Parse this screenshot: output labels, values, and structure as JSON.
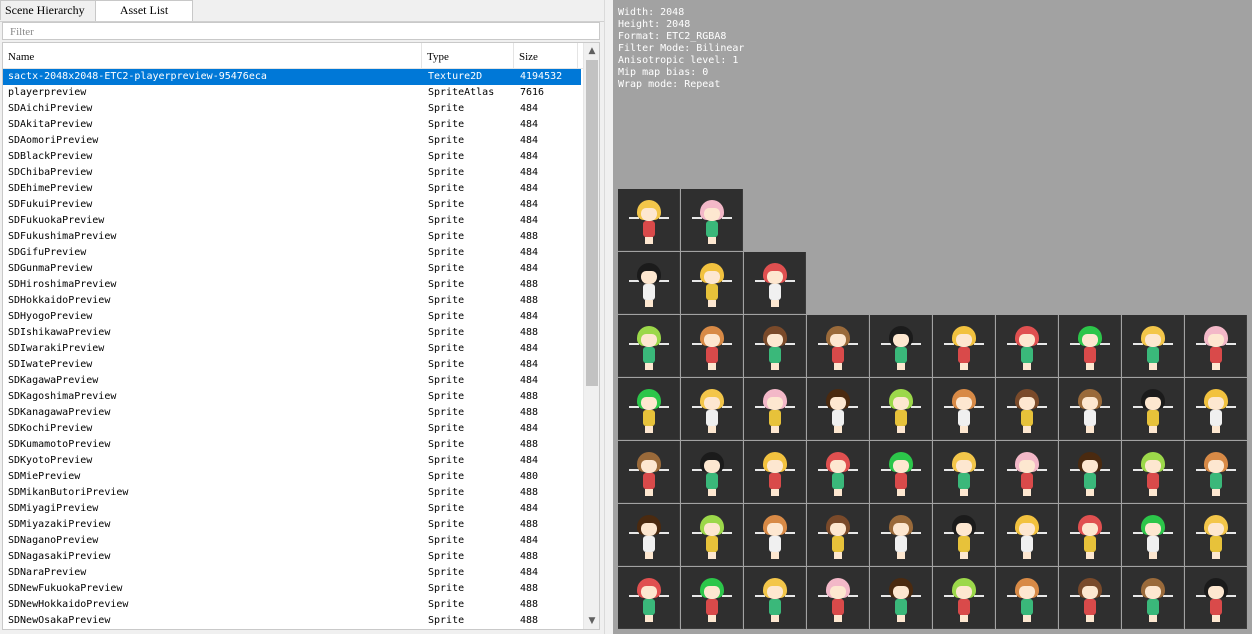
{
  "tabs": [
    "Scene Hierarchy",
    "Asset List"
  ],
  "filter_placeholder": "Filter",
  "columns": [
    "Name",
    "Type",
    "Size"
  ],
  "scroll": {
    "up": "▲",
    "down": "▼"
  },
  "rows": [
    {
      "name": "sactx-2048x2048-ETC2-playerpreview-95476eca",
      "type": "Texture2D",
      "size": "4194532",
      "selected": true
    },
    {
      "name": "playerpreview",
      "type": "SpriteAtlas",
      "size": "7616"
    },
    {
      "name": "SDAichiPreview",
      "type": "Sprite",
      "size": "484"
    },
    {
      "name": "SDAkitaPreview",
      "type": "Sprite",
      "size": "484"
    },
    {
      "name": "SDAomoriPreview",
      "type": "Sprite",
      "size": "484"
    },
    {
      "name": "SDBlackPreview",
      "type": "Sprite",
      "size": "484"
    },
    {
      "name": "SDChibaPreview",
      "type": "Sprite",
      "size": "484"
    },
    {
      "name": "SDEhimePreview",
      "type": "Sprite",
      "size": "484"
    },
    {
      "name": "SDFukuiPreview",
      "type": "Sprite",
      "size": "484"
    },
    {
      "name": "SDFukuokaPreview",
      "type": "Sprite",
      "size": "484"
    },
    {
      "name": "SDFukushimaPreview",
      "type": "Sprite",
      "size": "488"
    },
    {
      "name": "SDGifuPreview",
      "type": "Sprite",
      "size": "484"
    },
    {
      "name": "SDGunmaPreview",
      "type": "Sprite",
      "size": "484"
    },
    {
      "name": "SDHiroshimaPreview",
      "type": "Sprite",
      "size": "488"
    },
    {
      "name": "SDHokkaidoPreview",
      "type": "Sprite",
      "size": "488"
    },
    {
      "name": "SDHyogoPreview",
      "type": "Sprite",
      "size": "484"
    },
    {
      "name": "SDIshikawaPreview",
      "type": "Sprite",
      "size": "488"
    },
    {
      "name": "SDIwarakiPreview",
      "type": "Sprite",
      "size": "484"
    },
    {
      "name": "SDIwatePreview",
      "type": "Sprite",
      "size": "484"
    },
    {
      "name": "SDKagawaPreview",
      "type": "Sprite",
      "size": "484"
    },
    {
      "name": "SDKagoshimaPreview",
      "type": "Sprite",
      "size": "488"
    },
    {
      "name": "SDKanagawaPreview",
      "type": "Sprite",
      "size": "488"
    },
    {
      "name": "SDKochiPreview",
      "type": "Sprite",
      "size": "484"
    },
    {
      "name": "SDKumamotoPreview",
      "type": "Sprite",
      "size": "488"
    },
    {
      "name": "SDKyotoPreview",
      "type": "Sprite",
      "size": "484"
    },
    {
      "name": "SDMiePreview",
      "type": "Sprite",
      "size": "480"
    },
    {
      "name": "SDMikanButoriPreview",
      "type": "Sprite",
      "size": "488"
    },
    {
      "name": "SDMiyagiPreview",
      "type": "Sprite",
      "size": "484"
    },
    {
      "name": "SDMiyazakiPreview",
      "type": "Sprite",
      "size": "488"
    },
    {
      "name": "SDNaganoPreview",
      "type": "Sprite",
      "size": "484"
    },
    {
      "name": "SDNagasakiPreview",
      "type": "Sprite",
      "size": "488"
    },
    {
      "name": "SDNaraPreview",
      "type": "Sprite",
      "size": "484"
    },
    {
      "name": "SDNewFukuokaPreview",
      "type": "Sprite",
      "size": "488"
    },
    {
      "name": "SDNewHokkaidoPreview",
      "type": "Sprite",
      "size": "488"
    },
    {
      "name": "SDNewOsakaPreview",
      "type": "Sprite",
      "size": "488"
    }
  ],
  "texture_info": {
    "width": "Width: 2048",
    "height": "Height: 2048",
    "format": "Format: ETC2_RGBA8",
    "filter": "Filter Mode: Bilinear",
    "aniso": "Anisotropic level: 1",
    "mipbias": "Mip map bias: 0",
    "wrap": "Wrap mode: Repeat"
  },
  "preview_grid": {
    "rows": [
      2,
      3,
      10,
      10,
      10,
      10,
      10
    ],
    "hair_colors": [
      "#f3c64a",
      "#f2c23f",
      "#7a4a2a",
      "#4a2a10",
      "#2cc64a",
      "#1b1b1b",
      "#d88a46",
      "#f3b8c8",
      "#e05050",
      "#9a6a3a",
      "#9cd84a"
    ],
    "outfit_colors": [
      "#d94a4a",
      "#3a7ad9",
      "#e7c23a",
      "#8a4ad9",
      "#3ab87a",
      "#e07ab0",
      "#f0f0f0",
      "#2a2a2a"
    ]
  },
  "colors": {
    "selection": "#0078d7",
    "preview_bg": "#a2a2a2",
    "tile_bg": "#2f2f2f"
  }
}
